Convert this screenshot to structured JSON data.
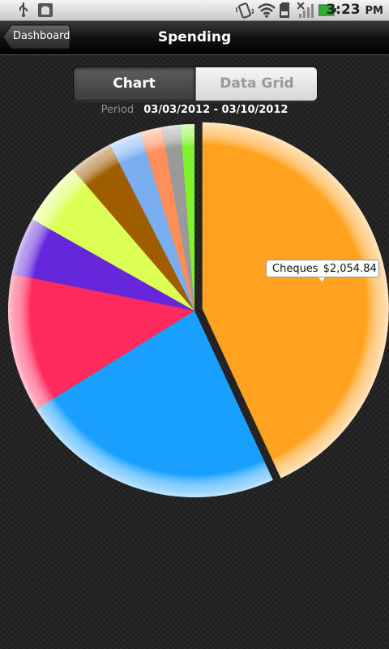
{
  "status_bar": {
    "time": "3:23",
    "ampm": "PM",
    "icons": [
      "usb-icon",
      "android-debug-icon",
      "vibrate-icon",
      "wifi-icon",
      "sd-card-icon",
      "no-signal-icon",
      "battery-icon"
    ]
  },
  "title_bar": {
    "back_label": "Dashboard",
    "title": "Spending"
  },
  "segmented": {
    "chart_label": "Chart",
    "grid_label": "Data Grid",
    "selected": "Chart"
  },
  "period": {
    "label": "Period",
    "value": "03/03/2012 - 03/10/2012"
  },
  "tooltip": {
    "category": "Cheques",
    "amount": "$2,054.84"
  },
  "chart_data": {
    "type": "pie",
    "title": "",
    "exploded_slice": 0,
    "slices": [
      {
        "value": 43.0,
        "color": "#ffa21f"
      },
      {
        "value": 23.0,
        "color": "#19a0ff"
      },
      {
        "value": 12.0,
        "color": "#ff2a5d"
      },
      {
        "value": 5.0,
        "color": "#6627dc"
      },
      {
        "value": 5.5,
        "color": "#ddff55"
      },
      {
        "value": 3.8,
        "color": "#a05d00"
      },
      {
        "value": 2.8,
        "color": "#7aaef0"
      },
      {
        "value": 1.9,
        "color": "#ff8f5a"
      },
      {
        "value": 1.6,
        "color": "#9a9a9a"
      },
      {
        "value": 1.2,
        "color": "#7ff22a"
      }
    ]
  }
}
